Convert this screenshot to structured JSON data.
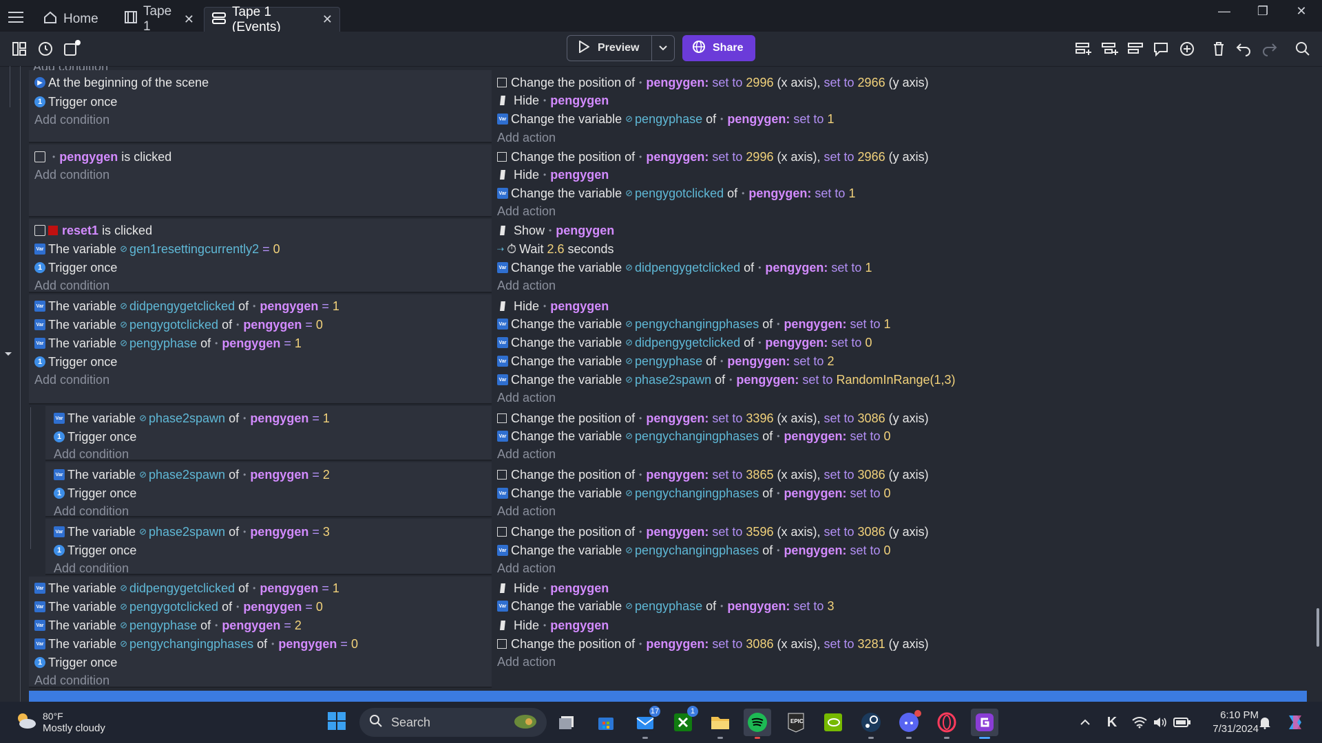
{
  "tabs": [
    {
      "label": "Home"
    },
    {
      "label": "Tape 1"
    },
    {
      "label": "Tape 1 (Events)"
    }
  ],
  "toolbar": {
    "preview": "Preview",
    "share": "Share"
  },
  "common": {
    "add_condition": "Add condition",
    "add_action": "Add action",
    "trigger_once": "Trigger once",
    "the_variable": "The variable",
    "change_variable": "Change the variable",
    "change_position": "Change the position of",
    "of": "of",
    "hide": "Hide",
    "show": "Show",
    "set_to": "set to",
    "x_axis": "(x axis),",
    "y_axis": "(y axis)",
    "pengygen": "pengygen",
    "pengygen_colon": "pengygen:",
    "eq": "="
  },
  "events": {
    "e1": {
      "cond1": "At the beginning of the scene",
      "a1x": "2996",
      "a1y": "2966",
      "a3var": "pengyphase",
      "a3val": "1"
    },
    "e2": {
      "obj": "pengygen",
      "is_clicked": "is clicked",
      "a1x": "2996",
      "a1y": "2966",
      "a3var": "pengygotclicked",
      "a3val": "1"
    },
    "e3": {
      "obj": "reset1",
      "is_clicked": "is clicked",
      "c2var": "gen1resettingcurrently2",
      "c2val": "0",
      "wait": "Wait",
      "wait_val": "2.6",
      "seconds": "seconds",
      "a3var": "didpengygetclicked",
      "a3val": "1"
    },
    "e4": {
      "c1var": "didpengygetclicked",
      "c1val": "1",
      "c2var": "pengygotclicked",
      "c2val": "0",
      "c3var": "pengyphase",
      "c3val": "1",
      "a2var": "pengychangingphases",
      "a2val": "1",
      "a3var": "didpengygetclicked",
      "a3val": "0",
      "a4var": "pengyphase",
      "a4val": "2",
      "a5var": "phase2spawn",
      "a5val": "RandomInRange(1,3)"
    },
    "e5": {
      "var": "phase2spawn",
      "val": "1",
      "ax": "3396",
      "ay": "3086",
      "a2var": "pengychangingphases",
      "a2val": "0"
    },
    "e6": {
      "var": "phase2spawn",
      "val": "2",
      "ax": "3865",
      "ay": "3086",
      "a2var": "pengychangingphases",
      "a2val": "0"
    },
    "e7": {
      "var": "phase2spawn",
      "val": "3",
      "ax": "3596",
      "ay": "3086",
      "a2var": "pengychangingphases",
      "a2val": "0"
    },
    "e8": {
      "c1var": "didpengygetclicked",
      "c1val": "1",
      "c2var": "pengygotclicked",
      "c2val": "0",
      "c3var": "pengyphase",
      "c3val": "2",
      "c4var": "pengychangingphases",
      "c4val": "0",
      "a2var": "pengyphase",
      "a2val": "3",
      "a4x": "3086",
      "a4y": "3281"
    }
  },
  "taskbar": {
    "weather_temp": "80°F",
    "weather_desc": "Mostly cloudy",
    "search": "Search",
    "time": "6:10 PM",
    "date": "7/31/2024",
    "badge_mail": "17",
    "badge_xbox": "1"
  },
  "colors": {
    "accent": "#6b3bd9",
    "object": "#d38bff",
    "variable": "#5fb8d6",
    "number": "#f2d27b",
    "keyword": "#b390f5"
  }
}
